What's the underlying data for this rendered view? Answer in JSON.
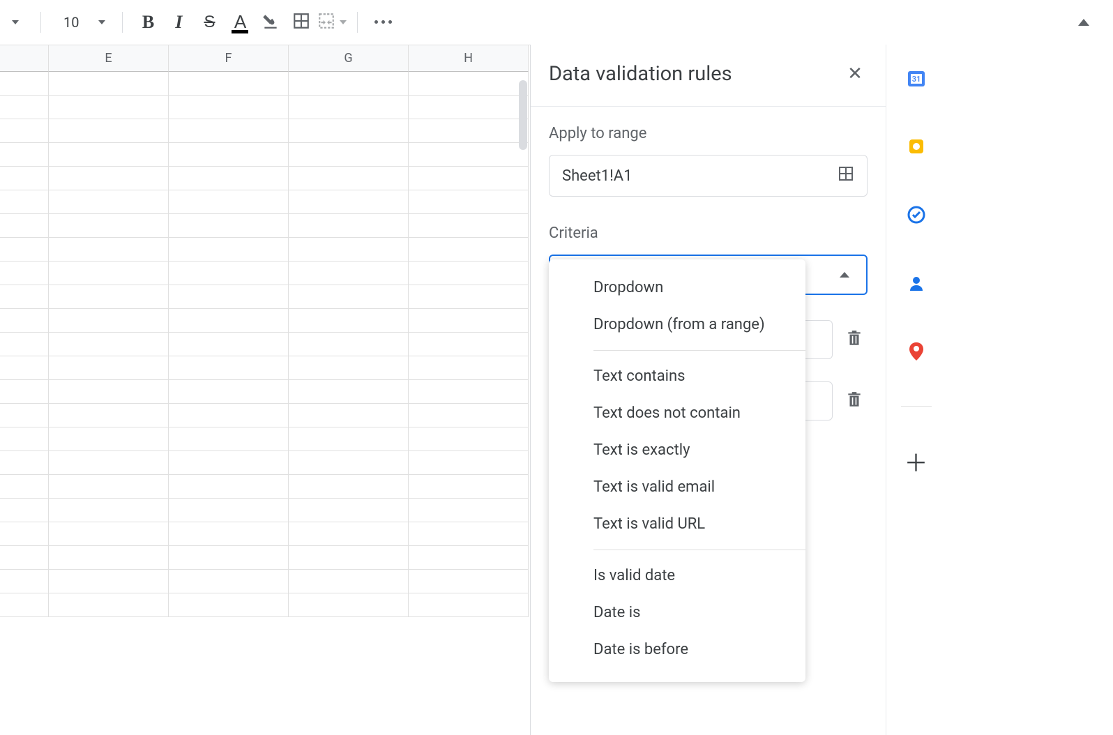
{
  "toolbar": {
    "font_size": "10"
  },
  "grid": {
    "columns": [
      "E",
      "F",
      "G",
      "H"
    ]
  },
  "panel": {
    "title": "Data validation rules",
    "apply_to_range_label": "Apply to range",
    "range_value": "Sheet1!A1",
    "criteria_label": "Criteria",
    "criteria_options": [
      "Dropdown",
      "Dropdown (from a range)",
      "Text contains",
      "Text does not contain",
      "Text is exactly",
      "Text is valid email",
      "Text is valid URL",
      "Is valid date",
      "Date is",
      "Date is before"
    ]
  },
  "rail": {
    "items": [
      "calendar",
      "keep",
      "tasks",
      "contacts",
      "maps"
    ]
  }
}
